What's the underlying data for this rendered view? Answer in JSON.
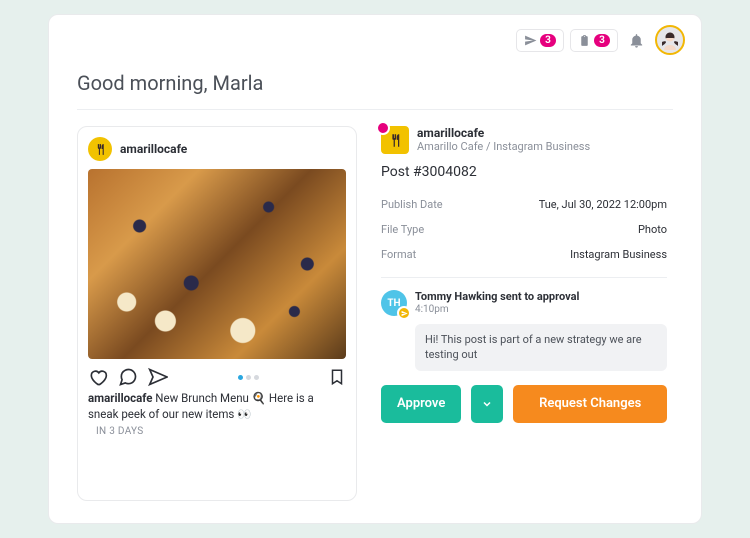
{
  "header": {
    "send_badge": "3",
    "clip_badge": "3"
  },
  "greeting": "Good morning, Marla",
  "post": {
    "username": "amarillocafe",
    "caption_user": "amarillocafe",
    "caption_text": " New Brunch Menu 🍳 Here is a sneak peek of our new items 👀",
    "when": "IN 3 DAYS"
  },
  "details": {
    "account_name": "amarillocafe",
    "account_sub": "Amarillo Cafe / Instagram Business",
    "post_id": "Post #3004082",
    "publish_label": "Publish Date",
    "publish_value": "Tue, Jul 30, 2022 12:00pm",
    "filetype_label": "File Type",
    "filetype_value": "Photo",
    "format_label": "Format",
    "format_value": "Instagram Business"
  },
  "activity": {
    "avatar_initials": "TH",
    "title": "Tommy Hawking sent to approval",
    "time": "4:10pm",
    "message": "Hi! This post is part of a new strategy we are testing out"
  },
  "buttons": {
    "approve": "Approve",
    "request": "Request Changes"
  }
}
